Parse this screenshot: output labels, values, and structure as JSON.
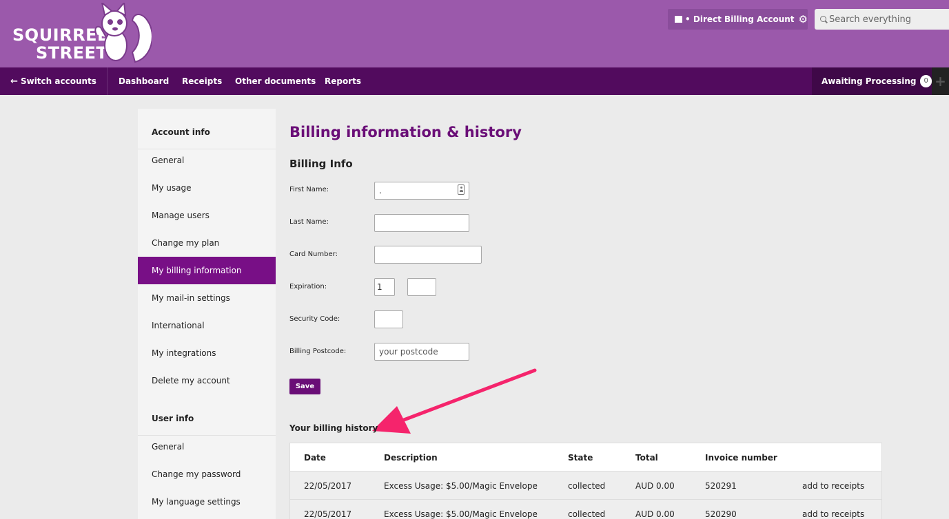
{
  "brand": {
    "line1": "SQUIRREL",
    "line2": "STREET"
  },
  "header": {
    "account_label": "• Direct Billing Account",
    "search_placeholder": "Search everything"
  },
  "nav": {
    "switch_label": "Switch accounts",
    "items": [
      "Dashboard",
      "Receipts",
      "Other documents",
      "Reports"
    ],
    "awaiting_label": "Awaiting Processing",
    "awaiting_count": "0",
    "plus_label": "+"
  },
  "sidebar": {
    "account_heading": "Account info",
    "account_items": [
      "General",
      "My usage",
      "Manage users",
      "Change my plan",
      "My billing information",
      "My mail-in settings",
      "International",
      "My integrations",
      "Delete my account"
    ],
    "active_item": "My billing information",
    "user_heading": "User info",
    "user_items": [
      "General",
      "Change my password",
      "My language settings"
    ]
  },
  "main": {
    "title": "Billing information & history",
    "subtitle": "Billing Info",
    "form": {
      "first_name_label": "First Name:",
      "first_name_value": ".",
      "last_name_label": "Last Name:",
      "last_name_value": "",
      "card_label": "Card Number:",
      "card_value": "",
      "expiration_label": "Expiration:",
      "exp_month_value": "1",
      "exp_year_value": "",
      "security_label": "Security Code:",
      "security_value": "",
      "postcode_label": "Billing Postcode:",
      "postcode_placeholder": "your postcode",
      "save_label": "Save"
    },
    "history_title": "Your billing history",
    "table": {
      "headers": [
        "Date",
        "Description",
        "State",
        "Total",
        "Invoice number",
        ""
      ],
      "rows": [
        [
          "22/05/2017",
          "Excess Usage: $5.00/Magic Envelope",
          "collected",
          "AUD 0.00",
          "520291",
          "add to receipts"
        ],
        [
          "22/05/2017",
          "Excess Usage: $5.00/Magic Envelope",
          "collected",
          "AUD 0.00",
          "520290",
          "add to receipts"
        ]
      ]
    }
  },
  "colors": {
    "header_bg": "#9b59ab",
    "nav_bg": "#520b5e",
    "accent": "#780f86",
    "title": "#6a0e77",
    "annotation": "#f5246c"
  }
}
